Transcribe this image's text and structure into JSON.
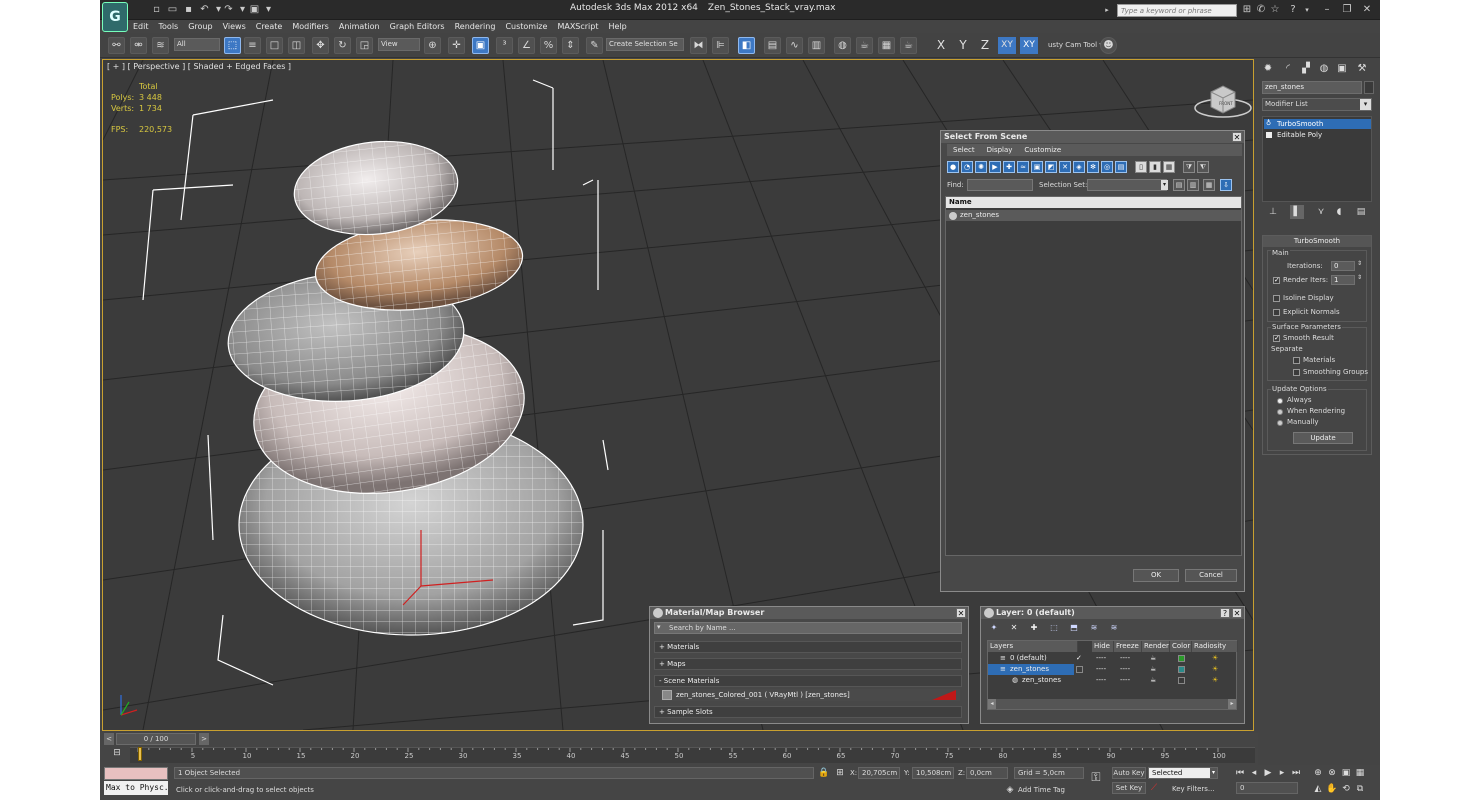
{
  "app": {
    "title": "Autodesk 3ds Max  2012 x64",
    "file": "Zen_Stones_Stack_vray.max",
    "search_placeholder": "Type a keyword or phrase",
    "logo": "G"
  },
  "menu": [
    "Edit",
    "Tools",
    "Group",
    "Views",
    "Create",
    "Modifiers",
    "Animation",
    "Graph Editors",
    "Rendering",
    "Customize",
    "MAXScript",
    "Help"
  ],
  "toolbar": {
    "filter": "All",
    "ref_coord": "View",
    "selection_set": "Create Selection Se",
    "trusty": "usty Cam Tool v",
    "axis_x": "X",
    "axis_y": "Y",
    "axis_z": "Z",
    "axis_xy": "XY",
    "axis_xy2": "XY"
  },
  "viewport": {
    "label": "[ + ] [ Perspective ] [ Shaded + Edged Faces ]",
    "stats": {
      "total": "Total",
      "polys_label": "Polys:",
      "polys": "3 448",
      "verts_label": "Verts:",
      "verts": "1 734",
      "fps_label": "FPS:",
      "fps": "220,573"
    },
    "viewcube": "FRONT"
  },
  "select_from_scene": {
    "title": "Select From Scene",
    "menu": [
      "Select",
      "Display",
      "Customize"
    ],
    "find_label": "Find:",
    "selset_label": "Selection Set:",
    "column_name": "Name",
    "objects": [
      "zen_stones"
    ],
    "ok": "OK",
    "cancel": "Cancel"
  },
  "material_browser": {
    "title": "Material/Map Browser",
    "search_placeholder": "Search by Name ...",
    "sections": {
      "materials": "+ Materials",
      "maps": "+ Maps",
      "scene_materials": "- Scene Materials",
      "scene_item": "zen_stones_Colored_001  ( VRayMtl )  [zen_stones]",
      "sample_slots": "+ Sample Slots"
    },
    "swatch_color": "#c01818"
  },
  "layer_manager": {
    "title": "Layer: 0 (default)",
    "columns": [
      "Layers",
      "Hide",
      "Freeze",
      "Render",
      "Color",
      "Radiosity"
    ],
    "rows": [
      {
        "name": "0 (default)",
        "hide": "----",
        "freeze": "----",
        "color": "#2a9a2a"
      },
      {
        "name": "zen_stones",
        "hide": "----",
        "freeze": "----",
        "color": "#2a8a8a"
      },
      {
        "name": "zen_stones",
        "hide": "----",
        "freeze": "----",
        "color": "#3a3a3a"
      }
    ]
  },
  "command_panel": {
    "object_name": "zen_stones",
    "modifier_list": "Modifier List",
    "stack": [
      "TurboSmooth",
      "Editable Poly"
    ],
    "turbosmooth": {
      "title": "TurboSmooth",
      "main": "Main",
      "iterations_label": "Iterations:",
      "iterations": "0",
      "render_iters_label": "Render Iters:",
      "render_iters": "1",
      "isoline": "Isoline Display",
      "explicit": "Explicit Normals",
      "surface_params": "Surface Parameters",
      "smooth_result": "Smooth Result",
      "separate": "Separate",
      "materials": "Materials",
      "smoothing_groups": "Smoothing Groups",
      "update_options": "Update Options",
      "always": "Always",
      "when_rendering": "When Rendering",
      "manually": "Manually",
      "update": "Update"
    }
  },
  "timeline": {
    "frame": "0 / 100",
    "ticks": [
      "0",
      "5",
      "10",
      "15",
      "20",
      "25",
      "30",
      "35",
      "40",
      "45",
      "50",
      "55",
      "60",
      "65",
      "70",
      "75",
      "80",
      "85",
      "90",
      "95",
      "100"
    ]
  },
  "status": {
    "maxscript_out": "Max to Physc.",
    "selected": "1 Object Selected",
    "prompt": "Click or click-and-drag to select objects",
    "x_label": "X:",
    "x": "20,705cm",
    "y_label": "Y:",
    "y": "10,508cm",
    "z_label": "Z:",
    "z": "0,0cm",
    "grid": "Grid = 5,0cm",
    "add_time_tag": "Add Time Tag",
    "auto_key": "Auto Key",
    "set_key": "Set Key",
    "selected_dd": "Selected",
    "key_filters": "Key Filters...",
    "frame": "0"
  }
}
